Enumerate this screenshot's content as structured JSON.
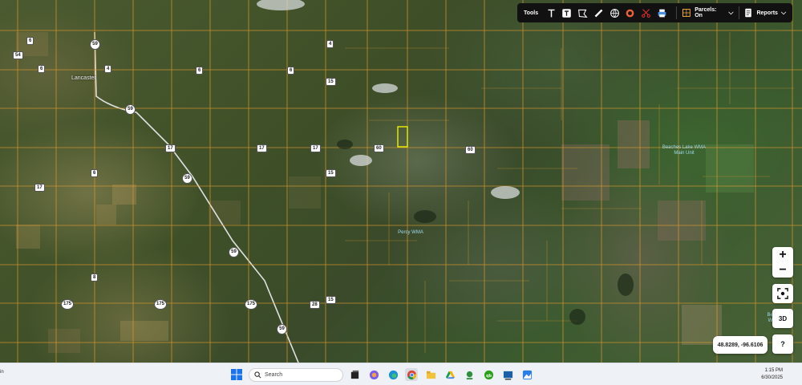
{
  "map": {
    "place_label": "Lancaster",
    "feature_labels": [
      "Beaches Lake WMA Main Unit",
      "Percy WMA",
      "Beach WMA"
    ],
    "road_shields": [
      "54",
      "6",
      "59",
      "4",
      "6",
      "6",
      "59",
      "4",
      "6",
      "15",
      "17",
      "17",
      "17",
      "60",
      "60",
      "59",
      "6",
      "15",
      "17",
      "59",
      "8",
      "175",
      "175",
      "175",
      "28",
      "15",
      "59"
    ]
  },
  "toolbar": {
    "tools_label": "Tools",
    "parcels_label": "Parcels: On",
    "reports_label": "Reports",
    "icons": [
      "text-tool-icon",
      "text-box-icon",
      "polygon-icon",
      "ruler-icon",
      "globe-icon",
      "circle-target-icon",
      "scissors-icon",
      "printer-icon",
      "parcels-icon",
      "reports-icon"
    ]
  },
  "controls": {
    "zoom_in": "+",
    "zoom_out": "−",
    "three_d": "3D",
    "help": "?",
    "coordinates": "48.8289, -96.6106"
  },
  "taskbar": {
    "left_fragment": "in",
    "search_placeholder": "Search",
    "time": "1:15 PM",
    "date": "6/30/2025"
  },
  "colors": {
    "parcel_line": "#e09a2e",
    "selected_parcel": "#f0f000",
    "toolbar_bg": "#111111"
  }
}
